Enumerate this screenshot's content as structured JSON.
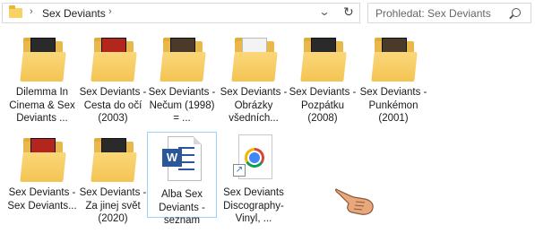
{
  "address": {
    "breadcrumb": "Sex Deviants",
    "separator_left": "›",
    "separator_right": "›",
    "dropdown_glyph": "⌄",
    "refresh_glyph": "↻"
  },
  "search": {
    "placeholder": "Prohledat: Sex Deviants"
  },
  "items": [
    {
      "label": "Dilemma In Cinema & Sex Deviants ...",
      "icon": "folder-icon"
    },
    {
      "label": "Sex Deviants - Cesta do očí (2003)",
      "icon": "folder-icon"
    },
    {
      "label": "Sex Deviants - Nečum (1998) = ...",
      "icon": "folder-icon"
    },
    {
      "label": "Sex Deviants - Obrázky všedních...",
      "icon": "folder-icon"
    },
    {
      "label": "Sex Deviants - Pozpátku (2008)",
      "icon": "folder-icon"
    },
    {
      "label": "Sex Deviants - Punkémon (2001)",
      "icon": "folder-icon"
    },
    {
      "label": "Sex Deviants - Sex Deviants...",
      "icon": "folder-icon"
    },
    {
      "label": "Sex Deviants - Za jinej svět (2020)",
      "icon": "folder-icon"
    },
    {
      "label": "Alba Sex Deviants - seznam",
      "icon": "word-document-icon"
    },
    {
      "label": "Sex Deviants Discography- Vinyl, ...",
      "icon": "chrome-shortcut-icon"
    }
  ],
  "word_badge": "W",
  "shortcut_arrow": "↗",
  "colors": {
    "folder": "#f7d365",
    "selection_border": "#99d1ff",
    "word_blue": "#2b579a"
  }
}
